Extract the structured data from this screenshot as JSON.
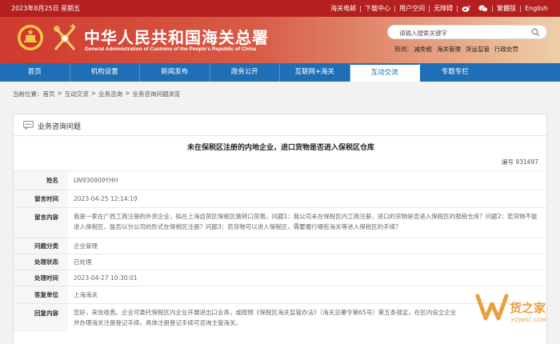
{
  "topbar": {
    "date": "2023年8月25日 星期五",
    "links": [
      "海关电邮",
      "下载中心",
      "用户空间",
      "无障碍"
    ],
    "lang_traditional": "繁體版",
    "lang_english": "English"
  },
  "header": {
    "title_cn": "中华人民共和国海关总署",
    "title_en": "General Administration of Customs of the People's Republic of China",
    "search_placeholder": "请输入搜索关键字",
    "hot_label": "热词：",
    "hot_words": [
      "减免税",
      "海关管理",
      "货运监管",
      "行政处罚"
    ]
  },
  "nav": {
    "items": [
      "首页",
      "机构设置",
      "新闻发布",
      "政务公开",
      "互联网+海关",
      "互动交流",
      "专题专栏"
    ],
    "active_index": 5
  },
  "breadcrumb": {
    "prefix": "当前位置：",
    "items": [
      "首页",
      "互动交流",
      "业务咨询",
      "业务咨询问题浏览"
    ],
    "separator": ">"
  },
  "panel": {
    "heading": "业务咨询问题",
    "question_title": "未在保税区注册的内地企业，进口货物是否进入保税区仓库",
    "number_label": "编号",
    "number": "931497",
    "rows": [
      {
        "label": "姓名",
        "value": "LW930909YHH"
      },
      {
        "label": "留言时间",
        "value": "2023-04-25 12:14:19"
      },
      {
        "label": "留言内容",
        "value": "我是一家在广西工商注册的外资企业，拟在上海自贸区保税区做转口贸易。问题1：我公司未在保税区内工商注册，进口的货物是否进入保税区的报税仓库？问题2：若货物不能进入保税区，能否以分公司的形式在保税区注册？问题3：若货物可以进入保税区，需要履行哪些海关等进入保税区的手续？"
      },
      {
        "label": "问题分类",
        "value": "企业管理"
      },
      {
        "label": "处理状态",
        "value": "已处理"
      },
      {
        "label": "处理时间",
        "value": "2023-04-27 10:30:01"
      },
      {
        "label": "答复单位",
        "value": "上海海关"
      },
      {
        "label": "回复内容",
        "value": "您好，来信收悉。企业可委托保税区内企业开展进出口业务，或按照《保税区海关监管办法》（海关总署令第65号）第五条规定，在区内设立企业并办理海关注册登记手续，具体注册登记手续可咨询主管海关。"
      }
    ]
  },
  "watermark": {
    "brand": "货之家",
    "domain": "HZJWSC.COM"
  },
  "colors": {
    "top_red": "#b41f1f",
    "nav_blue": "#1f6fb6",
    "label_bg": "#f4f6f8"
  }
}
